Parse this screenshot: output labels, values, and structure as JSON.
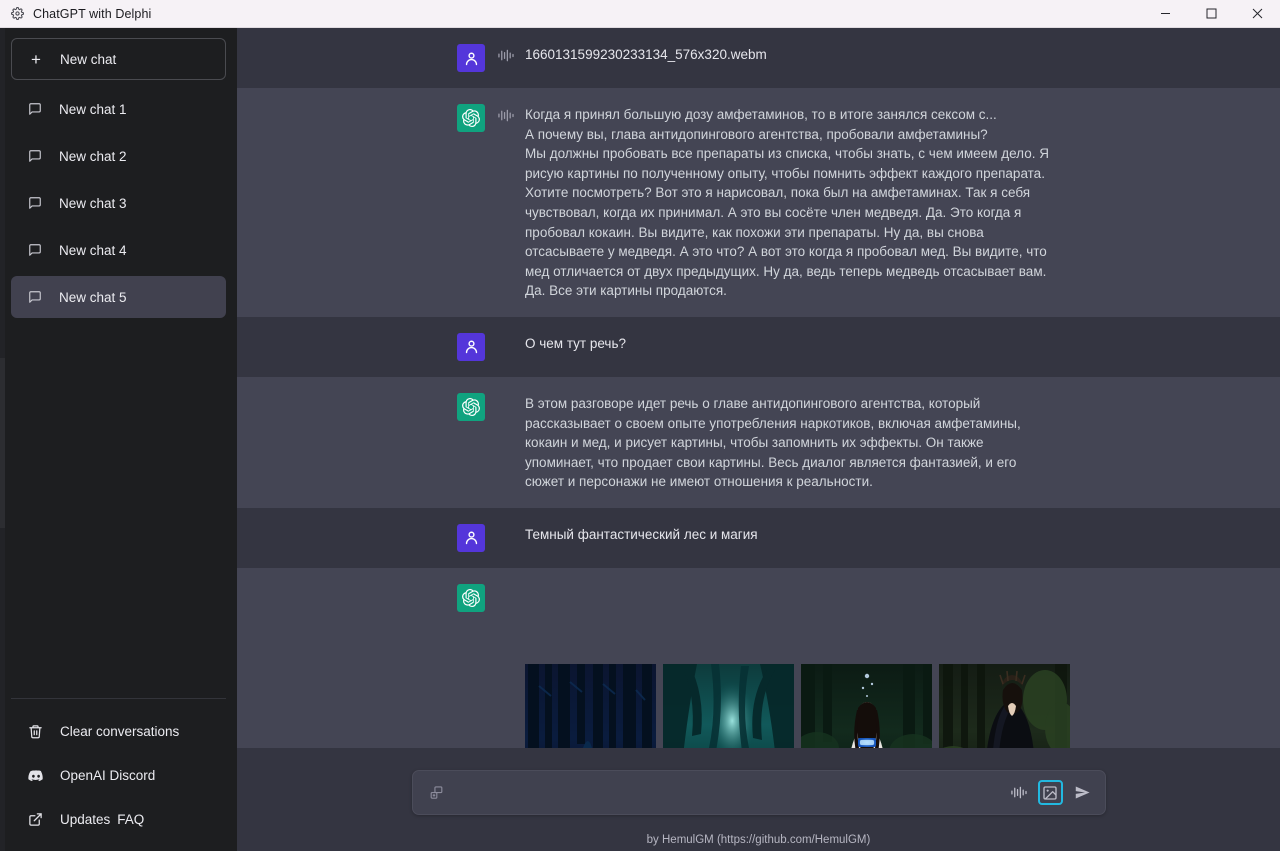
{
  "window": {
    "title": "ChatGPT with Delphi",
    "app_icon": "gear-icon",
    "minimize_label": "Minimize",
    "maximize_label": "Maximize",
    "close_label": "Close"
  },
  "sidebar": {
    "new_chat": {
      "label": "New chat",
      "icon": "plus-icon"
    },
    "chats": [
      {
        "label": "New chat 1",
        "icon": "message-square-icon",
        "active": false
      },
      {
        "label": "New chat 2",
        "icon": "message-square-icon",
        "active": false
      },
      {
        "label": "New chat 3",
        "icon": "message-square-icon",
        "active": false
      },
      {
        "label": "New chat 4",
        "icon": "message-square-icon",
        "active": false
      },
      {
        "label": "New chat 5",
        "icon": "message-square-icon",
        "active": true
      }
    ],
    "links": [
      {
        "label": "Clear conversations",
        "icon": "trash-icon"
      },
      {
        "label": "OpenAI Discord",
        "icon": "discord-icon"
      },
      {
        "label": "Updates",
        "label2": "FAQ",
        "icon": "external-link-icon"
      }
    ],
    "active_color": "#41414f"
  },
  "thread": {
    "messages": [
      {
        "role": "user",
        "avatar_icon": "user-avatar-icon",
        "avatar_color": "#5436da",
        "has_waveform": true,
        "text": "1660131599230233134_576x320.webm"
      },
      {
        "role": "assistant",
        "avatar_icon": "openai-logo-icon",
        "avatar_color": "#10a37f",
        "has_waveform": true,
        "text": "Когда я принял большую дозу амфетаминов, то в итоге занялся сексом с...\nА почему вы, глава антидопингового агентства, пробовали амфетамины?\nМы должны пробовать все препараты из списка, чтобы знать, с чем имеем дело. Я рисую картины по полученному опыту, чтобы помнить эффект каждого препарата. Хотите посмотреть? Вот это я нарисовал, пока был на амфетаминах. Так я себя чувствовал, когда их принимал. А это вы сосёте член медведя. Да. Это когда я пробовал кокаин. Вы видите, как похожи эти препараты. Ну да, вы снова отсасываете у медведя. А это что? А вот это когда я пробовал мед. Вы видите, что мед отличается от двух предыдущих. Ну да, ведь теперь медведь отсасывает вам. Да. Все эти картины продаются."
      },
      {
        "role": "user",
        "avatar_icon": "user-avatar-icon",
        "avatar_color": "#5436da",
        "has_waveform": false,
        "text": "О чем тут речь?"
      },
      {
        "role": "assistant",
        "avatar_icon": "openai-logo-icon",
        "avatar_color": "#10a37f",
        "has_waveform": false,
        "text": "В этом разговоре идет речь о главе антидопингового агентства, который рассказывает о своем опыте употребления наркотиков, включая амфетамины, кокаин и мед, и рисует картины, чтобы запомнить их эффекты. Он также упоминает, что продает свои картины. Весь диалог является фантазией, и его сюжет и персонажи не имеют отношения к реальности."
      },
      {
        "role": "user",
        "avatar_icon": "user-avatar-icon",
        "avatar_color": "#5436da",
        "has_waveform": false,
        "text": "Темный фантастический лес и магия"
      },
      {
        "role": "assistant",
        "avatar_icon": "openai-logo-icon",
        "avatar_color": "#10a37f",
        "has_waveform": false,
        "images": [
          {
            "alt": "dark blue forest with glowing blue creature",
            "name": "generated-image-1"
          },
          {
            "alt": "teal misty forest path",
            "name": "generated-image-2"
          },
          {
            "alt": "woman in white dress holding glowing blue light in forest",
            "name": "generated-image-3"
          },
          {
            "alt": "woman in black cloak with crown in dark forest",
            "name": "generated-image-4"
          }
        ]
      }
    ]
  },
  "composer": {
    "placeholder": "",
    "value": "",
    "left_icon": "attach-template-icon",
    "actions": [
      {
        "icon": "waveform-icon",
        "name": "voice-input-button",
        "focused": false
      },
      {
        "icon": "image-icon",
        "name": "image-generate-button",
        "focused": true
      },
      {
        "icon": "send-icon",
        "name": "send-button",
        "focused": false
      }
    ],
    "focus_color": "#22b8e0"
  },
  "footer": {
    "text": "by HemulGM (https://github.com/HemulGM)"
  }
}
